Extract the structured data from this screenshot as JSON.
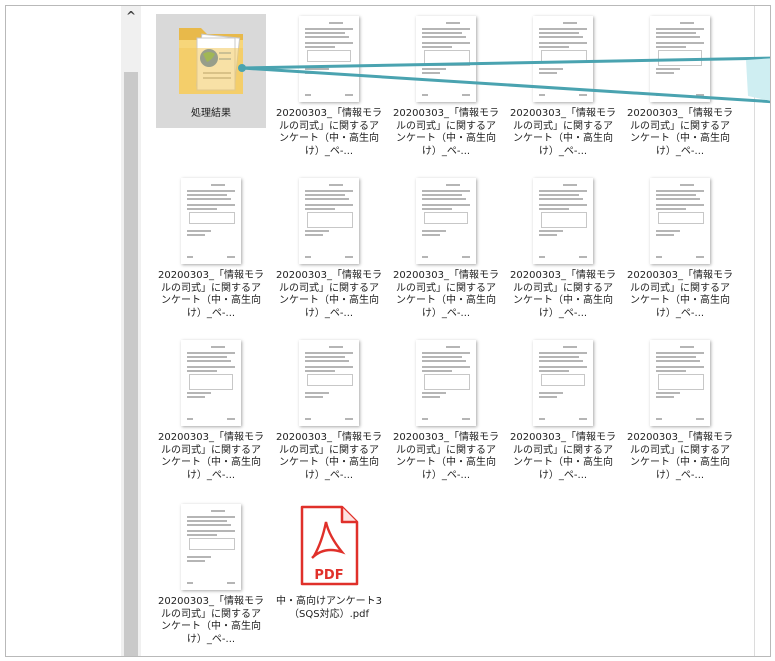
{
  "scrollbar": {
    "up_arrow": "^"
  },
  "folder": {
    "label": "処理結果"
  },
  "files": [
    {
      "label": "20200303_「情報モラルの司式」に関するアンケート（中・高生向け）_ペ-..."
    },
    {
      "label": "20200303_「情報モラルの司式」に関するアンケート（中・高生向け）_ペ-..."
    },
    {
      "label": "20200303_「情報モラルの司式」に関するアンケート（中・高生向け）_ペ-..."
    },
    {
      "label": "20200303_「情報モラルの司式」に関するアンケート（中・高生向け）_ペ-..."
    },
    {
      "label": "20200303_「情報モラルの司式」に関するアンケート（中・高生向け）_ペ-..."
    },
    {
      "label": "20200303_「情報モラルの司式」に関するアンケート（中・高生向け）_ペ-..."
    },
    {
      "label": "20200303_「情報モラルの司式」に関するアンケート（中・高生向け）_ペ-..."
    },
    {
      "label": "20200303_「情報モラルの司式」に関するアンケート（中・高生向け）_ペ-..."
    },
    {
      "label": "20200303_「情報モラルの司式」に関するアンケート（中・高生向け）_ペ-..."
    },
    {
      "label": "20200303_「情報モラルの司式」に関するアンケート（中・高生向け）_ペ-..."
    },
    {
      "label": "20200303_「情報モラルの司式」に関するアンケート（中・高生向け）_ペ-..."
    },
    {
      "label": "20200303_「情報モラルの司式」に関するアンケート（中・高生向け）_ペ-..."
    },
    {
      "label": "20200303_「情報モラルの司式」に関するアンケート（中・高生向け）_ペ-..."
    },
    {
      "label": "20200303_「情報モラルの司式」に関するアンケート（中・高生向け）_ペ-..."
    },
    {
      "label": "20200303_「情報モラルの司式」に関するアンケート（中・高生向け）_ペ-..."
    }
  ],
  "pdf_file": {
    "label": "中・高向けアンケート3（SQS対応）.pdf",
    "badge": "PDF"
  },
  "colors": {
    "selection": "#d9d9d9",
    "pdf_red": "#e0302a",
    "callout": "#4aa3b0",
    "callout_fill": "#cfeef2"
  }
}
